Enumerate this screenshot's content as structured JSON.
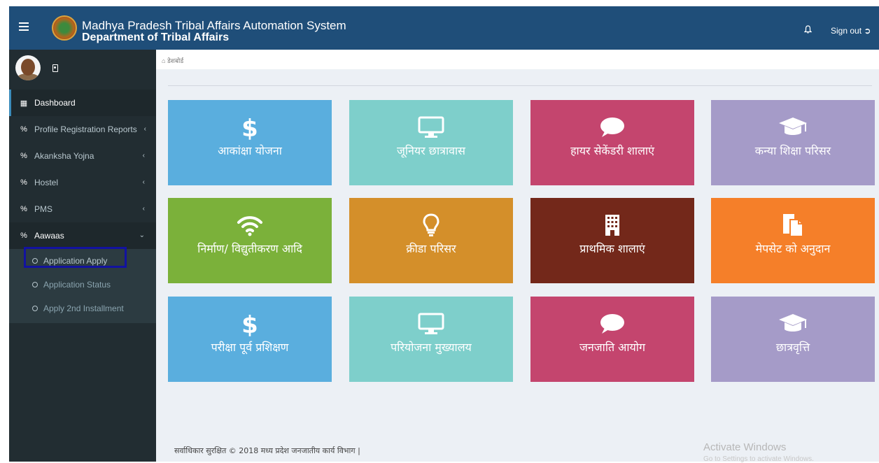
{
  "header": {
    "title": "Madhya Pradesh Tribal Affairs Automation System",
    "subtitle": "Department of Tribal Affairs",
    "signout_label": "Sign out",
    "bg_color": "#1f4e79"
  },
  "sidebar": {
    "items": [
      {
        "label": "Dashboard",
        "icon": "grid-icon"
      },
      {
        "label": "Profile Registration Reports",
        "icon": "link-icon"
      },
      {
        "label": "Akanksha Yojna",
        "icon": "link-icon"
      },
      {
        "label": "Hostel",
        "icon": "link-icon"
      },
      {
        "label": "PMS",
        "icon": "link-icon"
      },
      {
        "label": "Aawaas",
        "icon": "link-icon"
      }
    ],
    "submenu": [
      {
        "label": "Application Apply"
      },
      {
        "label": "Application Status"
      },
      {
        "label": "Apply 2nd Installment"
      }
    ]
  },
  "breadcrumb": {
    "label": "डेशबोर्ड"
  },
  "tiles": [
    {
      "label": "आकांक्षा योजना",
      "icon": "dollar-icon",
      "color": "#5aaede"
    },
    {
      "label": "जूनियर छात्रावास",
      "icon": "monitor-icon",
      "color": "#7ecfcb"
    },
    {
      "label": "हायर सेकेंडरी शालाएं",
      "icon": "chat-icon",
      "color": "#c4456e"
    },
    {
      "label": "कन्या शिक्षा परिसर",
      "icon": "graduation-cap-icon",
      "color": "#a59bc8"
    },
    {
      "label": "निर्माण/ विद्युतीकरण आदि",
      "icon": "wifi-icon",
      "color": "#7bb13a"
    },
    {
      "label": "क्रीडा परिसर",
      "icon": "lightbulb-icon",
      "color": "#d48f2a"
    },
    {
      "label": "प्राथमिक शालाएं",
      "icon": "building-icon",
      "color": "#73281a"
    },
    {
      "label": "मेपसेट को अनुदान",
      "icon": "document-icon",
      "color": "#f57f29"
    },
    {
      "label": "परीक्षा पूर्व प्रशिक्षण",
      "icon": "dollar-icon",
      "color": "#5aaede"
    },
    {
      "label": "परियोजना मुख्यालय",
      "icon": "monitor-icon",
      "color": "#7ecfcb"
    },
    {
      "label": "जनजाति आयोग",
      "icon": "chat-icon",
      "color": "#c4456e"
    },
    {
      "label": "छात्रवृत्ति",
      "icon": "graduation-cap-icon",
      "color": "#a59bc8"
    }
  ],
  "footer": {
    "text": "सर्वाधिकार सुरक्षित © 2018 मध्य प्रदेश जनजातीय कार्य विभाग |"
  },
  "watermark": {
    "line1": "Activate Windows",
    "line2": "Go to Settings to activate Windows."
  }
}
